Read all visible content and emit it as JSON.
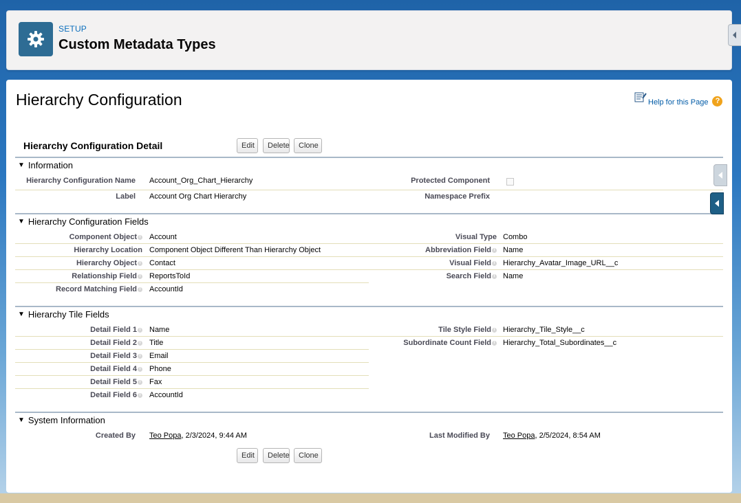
{
  "header": {
    "setup_label": "SETUP",
    "title": "Custom Metadata Types",
    "icon": "gear-icon"
  },
  "page": {
    "title": "Hierarchy Configuration",
    "help_label": "Help for this Page",
    "detail_title": "Hierarchy Configuration Detail"
  },
  "buttons": {
    "edit": "Edit",
    "delete": "Delete",
    "clone": "Clone"
  },
  "sections": {
    "information": "Information",
    "config_fields": "Hierarchy Configuration Fields",
    "tile_fields": "Hierarchy Tile Fields",
    "system_info": "System Information"
  },
  "information": {
    "name_label": "Hierarchy Configuration Name",
    "name_value": "Account_Org_Chart_Hierarchy",
    "protected_label": "Protected Component",
    "label_label": "Label",
    "label_value": "Account Org Chart Hierarchy",
    "namespace_label": "Namespace Prefix",
    "namespace_value": ""
  },
  "config_fields": {
    "left": [
      {
        "label": "Component Object",
        "value": "Account",
        "info": true
      },
      {
        "label": "Hierarchy Location",
        "value": "Component Object Different Than Hierarchy Object",
        "info": false
      },
      {
        "label": "Hierarchy Object",
        "value": "Contact",
        "info": true
      },
      {
        "label": "Relationship Field",
        "value": "ReportsToId",
        "info": true
      },
      {
        "label": "Record Matching Field",
        "value": "AccountId",
        "info": true
      }
    ],
    "right": [
      {
        "label": "Visual Type",
        "value": "Combo",
        "info": false
      },
      {
        "label": "Abbreviation Field",
        "value": "Name",
        "info": true
      },
      {
        "label": "Visual Field",
        "value": "Hierarchy_Avatar_Image_URL__c",
        "info": true
      },
      {
        "label": "Search Field",
        "value": "Name",
        "info": true
      }
    ]
  },
  "tile_fields": {
    "left": [
      {
        "label": "Detail Field 1",
        "value": "Name"
      },
      {
        "label": "Detail Field 2",
        "value": "Title"
      },
      {
        "label": "Detail Field 3",
        "value": "Email"
      },
      {
        "label": "Detail Field 4",
        "value": "Phone"
      },
      {
        "label": "Detail Field 5",
        "value": "Fax"
      },
      {
        "label": "Detail Field 6",
        "value": "AccountId"
      }
    ],
    "right": [
      {
        "label": "Tile Style Field",
        "value": "Hierarchy_Tile_Style__c"
      },
      {
        "label": "Subordinate Count Field",
        "value": "Hierarchy_Total_Subordinates__c"
      }
    ]
  },
  "system_info": {
    "created_label": "Created By",
    "created_user": "Teo Popa",
    "created_date": ", 2/3/2024, 9:44 AM",
    "modified_label": "Last Modified By",
    "modified_user": "Teo Popa",
    "modified_date": ", 2/5/2024, 8:54 AM"
  },
  "colors": {
    "brand": "#2e6c94",
    "link": "#015ba7",
    "section_rule": "#a8b8c8",
    "help_icon": "#f0a31c"
  }
}
